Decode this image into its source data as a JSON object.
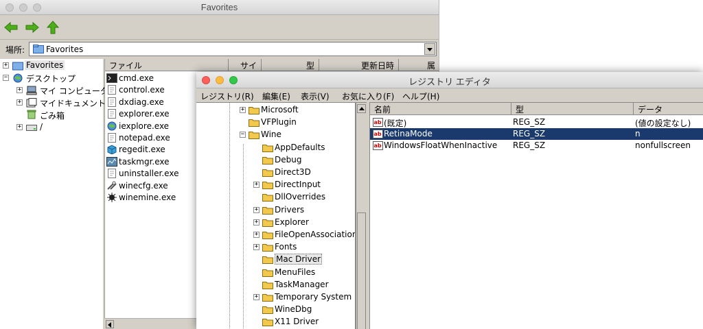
{
  "explorer": {
    "title": "Favorites",
    "address_label": "場所:",
    "address_value": "Favorites",
    "tree": [
      {
        "label": "Favorites",
        "icon": "favorites-folder-icon"
      },
      {
        "label": "デスクトップ",
        "icon": "desktop-icon"
      },
      {
        "label": "マイ コンピュータ",
        "icon": "my-computer-icon"
      },
      {
        "label": "マイドキュメント",
        "icon": "my-documents-icon"
      },
      {
        "label": "ごみ箱",
        "icon": "recycle-bin-icon"
      },
      {
        "label": "/",
        "icon": "drive-icon"
      }
    ],
    "columns": [
      "ファイル",
      "サイズ",
      "型",
      "更新日時",
      "属"
    ],
    "files": [
      {
        "name": "cmd.exe",
        "icon": "console-icon"
      },
      {
        "name": "control.exe",
        "icon": "document-icon"
      },
      {
        "name": "dxdiag.exe",
        "icon": "document-icon"
      },
      {
        "name": "explorer.exe",
        "icon": "document-icon"
      },
      {
        "name": "iexplore.exe",
        "icon": "globe-icon"
      },
      {
        "name": "notepad.exe",
        "icon": "document-icon"
      },
      {
        "name": "regedit.exe",
        "icon": "registry-icon"
      },
      {
        "name": "taskmgr.exe",
        "icon": "taskmgr-icon"
      },
      {
        "name": "uninstaller.exe",
        "icon": "document-icon"
      },
      {
        "name": "winecfg.exe",
        "icon": "tools-icon"
      },
      {
        "name": "winemine.exe",
        "icon": "mine-icon"
      }
    ]
  },
  "regedit": {
    "title": "レジストリ エディタ",
    "menu": [
      "レジストリ(R)",
      "編集(E)",
      "表示(V)",
      "お気に入り(F)",
      "ヘルプ(H)"
    ],
    "tree": [
      {
        "label": "Microsoft",
        "expander": "+"
      },
      {
        "label": "VFPlugin",
        "expander": ""
      },
      {
        "label": "Wine",
        "expander": "−"
      },
      {
        "label": "AppDefaults",
        "expander": ""
      },
      {
        "label": "Debug",
        "expander": ""
      },
      {
        "label": "Direct3D",
        "expander": ""
      },
      {
        "label": "DirectInput",
        "expander": "+"
      },
      {
        "label": "DllOverrides",
        "expander": ""
      },
      {
        "label": "Drivers",
        "expander": "+"
      },
      {
        "label": "Explorer",
        "expander": "+"
      },
      {
        "label": "FileOpenAssociations",
        "expander": "+"
      },
      {
        "label": "Fonts",
        "expander": "+"
      },
      {
        "label": "Mac Driver",
        "expander": ""
      },
      {
        "label": "MenuFiles",
        "expander": ""
      },
      {
        "label": "TaskManager",
        "expander": ""
      },
      {
        "label": "Temporary System Parameters",
        "expander": "+"
      },
      {
        "label": "WineDbg",
        "expander": ""
      },
      {
        "label": "X11 Driver",
        "expander": ""
      }
    ],
    "columns": [
      "名前",
      "型",
      "データ"
    ],
    "values": [
      {
        "name": "(既定)",
        "type": "REG_SZ",
        "data": "(値の設定なし)"
      },
      {
        "name": "RetinaMode",
        "type": "REG_SZ",
        "data": "n"
      },
      {
        "name": "WindowsFloatWhenInactive",
        "type": "REG_SZ",
        "data": "nonfullscreen"
      }
    ],
    "selected_value": "RetinaMode",
    "selected_key": "Mac Driver"
  },
  "colors": {
    "selection": "#1a3a6e",
    "folder": "#f2c94c",
    "window_bg": "#d4d0c8"
  }
}
